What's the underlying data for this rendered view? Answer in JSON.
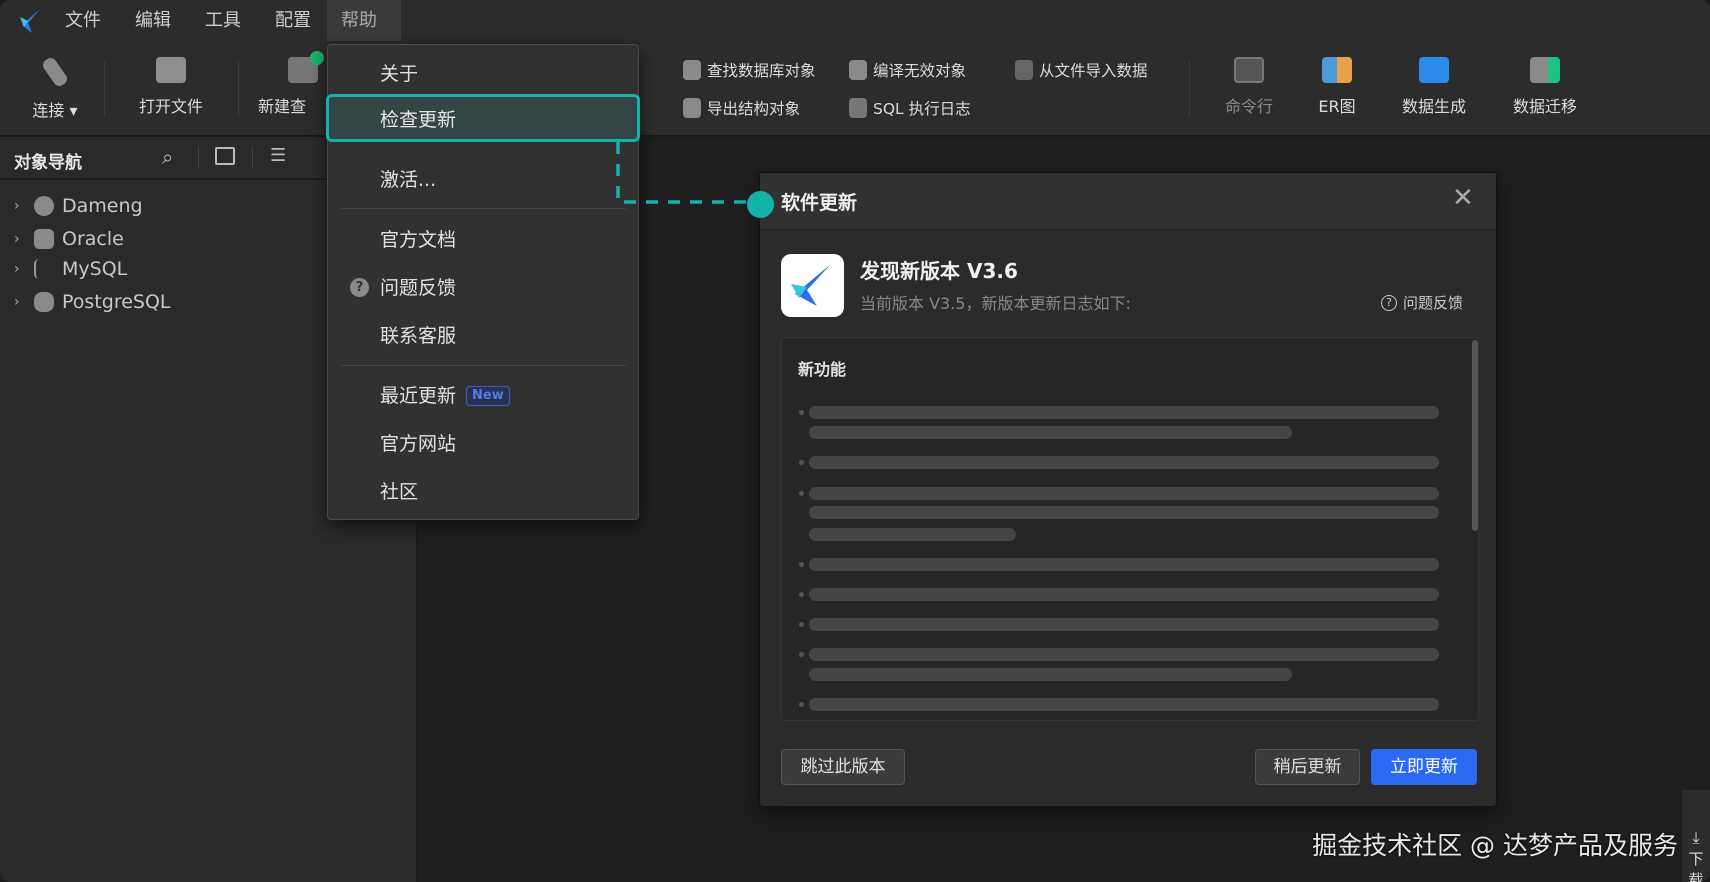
{
  "menubar": {
    "items": [
      "文件",
      "编辑",
      "工具",
      "配置",
      "帮助"
    ],
    "active": "帮助"
  },
  "toolbar": {
    "connect": "连接",
    "open_file": "打开文件",
    "new_query": "新建查",
    "find_db_objects": "查找数据库对象",
    "export_structure": "导出结构对象",
    "compile_invalid": "编译无效对象",
    "sql_log": "SQL 执行日志",
    "import_from_file": "从文件导入数据",
    "command_line": "命令行",
    "er_diagram": "ER图",
    "data_generation": "数据生成",
    "data_migration": "数据迁移"
  },
  "sidebar": {
    "title": "对象导航",
    "tree": [
      {
        "label": "Dameng"
      },
      {
        "label": "Oracle"
      },
      {
        "label": "MySQL"
      },
      {
        "label": "PostgreSQL"
      }
    ]
  },
  "help_menu": {
    "items": [
      {
        "label": "关于"
      },
      {
        "label": "检查更新",
        "highlighted": true
      },
      {
        "label": "激活..."
      },
      {
        "label": "官方文档"
      },
      {
        "label": "问题反馈",
        "icon": "question-circle-icon"
      },
      {
        "label": "联系客服"
      },
      {
        "label": "最近更新",
        "badge": "New"
      },
      {
        "label": "官方网站"
      },
      {
        "label": "社区"
      }
    ]
  },
  "dialog": {
    "title": "软件更新",
    "heading": "发现新版本 V3.6",
    "subtitle": "当前版本 V3.5，新版本更新日志如下:",
    "feedback_link": "问题反馈",
    "section_title": "新功能",
    "skip_button": "跳过此版本",
    "later_button": "稍后更新",
    "update_button": "立即更新"
  },
  "colors": {
    "accent_teal": "#13b3a9",
    "primary_blue": "#2c69f3",
    "badge_blue": "#4f7cf0"
  },
  "watermark": "掘金技术社区 @ 达梦产品及服务",
  "side_download": "下载"
}
